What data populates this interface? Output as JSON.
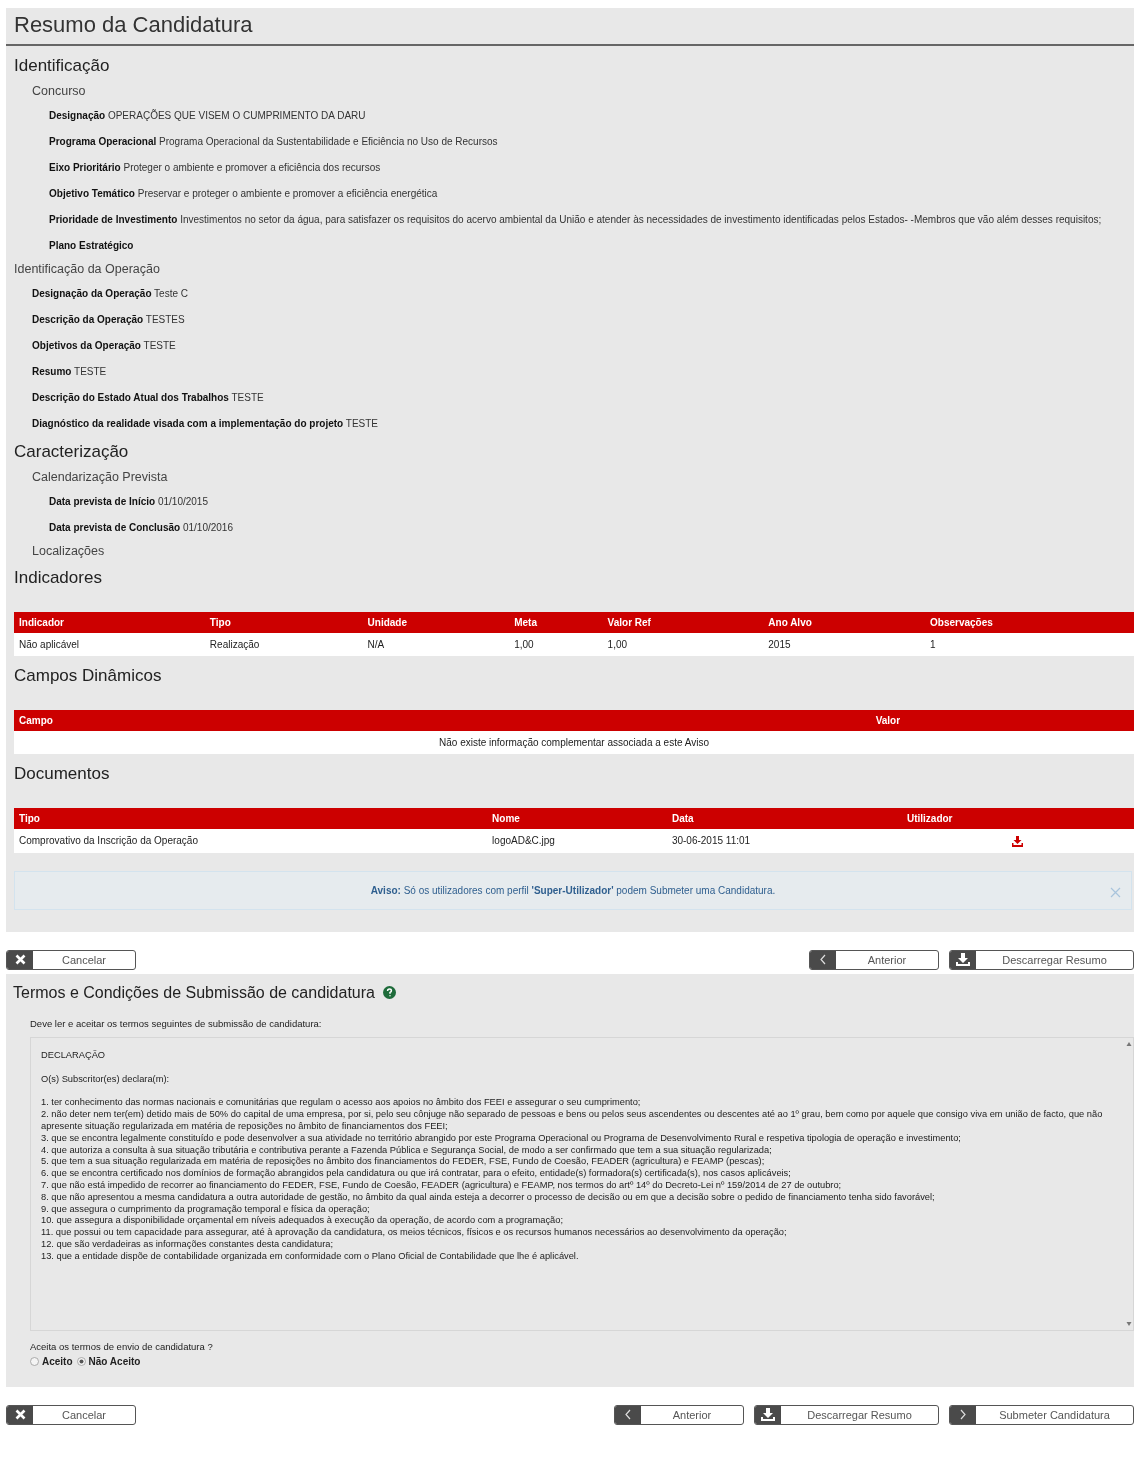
{
  "title": "Resumo da Candidatura",
  "sections": [
    {
      "heading": "Identificação",
      "groups": [
        {
          "kind": "subsection",
          "title": "Concurso",
          "fields": [
            {
              "label": "Designação",
              "value": "OPERAÇÕES QUE VISEM O CUMPRIMENTO DA DARU"
            },
            {
              "label": "Programa Operacional",
              "value": "Programa Operacional da Sustentabilidade e Eficiência no Uso de Recursos"
            },
            {
              "label": "Eixo Prioritário",
              "value": "Proteger o ambiente e promover a eficiência dos recursos"
            },
            {
              "label": "Objetivo Temático",
              "value": "Preservar e proteger o ambiente e promover a eficiência energética"
            },
            {
              "label": "Prioridade de Investimento",
              "value": "Investimentos no setor da água, para satisfazer os requisitos do acervo ambiental da União e atender às necessidades de investimento identificadas pelos Estados- -Membros que vão além desses requisitos;"
            },
            {
              "label": "Plano Estratégico"
            }
          ]
        },
        {
          "kind": "block",
          "title": "Identificação da Operação",
          "fields": [
            {
              "label": "Designação da Operação",
              "value": "Teste C"
            },
            {
              "label": "Descrição da Operação",
              "value": "TESTES"
            },
            {
              "label": "Objetivos da Operação",
              "value": "TESTE"
            },
            {
              "label": "Resumo",
              "value": "TESTE"
            },
            {
              "label": "Descrição do Estado Atual dos Trabalhos",
              "value": "TESTE"
            },
            {
              "label": "Diagnóstico da realidade visada com a implementação do projeto",
              "value": "TESTE"
            }
          ]
        }
      ]
    },
    {
      "heading": "Caracterização",
      "groups": [
        {
          "kind": "subsection",
          "title": "Calendarização Prevista",
          "fields": [
            {
              "label": "Data prevista de Início",
              "value": "01/10/2015"
            },
            {
              "label": "Data prevista de Conclusão",
              "value": "01/10/2016"
            }
          ]
        },
        {
          "kind": "subsection",
          "title": "Localizações"
        }
      ]
    },
    {
      "heading": "Indicadores",
      "table": {
        "columns": [
          "Indicador",
          "Tipo",
          "Unidade",
          "Meta",
          "Valor Ref",
          "Ano Alvo",
          "Observações"
        ],
        "rows": [
          {
            "cells": [
              "Não aplicável",
              "Realização",
              "N/A",
              "1,00",
              "1,00",
              "2015",
              "1"
            ]
          }
        ]
      }
    },
    {
      "heading": "Campos Dinâmicos",
      "table": {
        "columns": [
          "Campo",
          "Valor"
        ],
        "empty_message": "Não existe informação complementar associada a este Aviso"
      }
    },
    {
      "heading": "Documentos",
      "table": {
        "columns": [
          "Tipo",
          "Nome",
          "Data",
          "Utilizador"
        ],
        "rows": [
          {
            "cells": [
              "Comprovativo da Inscrição da Operação",
              "logoAD&C.jpg",
              "30-06-2015 11:01"
            ],
            "downloadable": true
          }
        ]
      }
    }
  ],
  "notice": {
    "text": "**Aviso:** Só os utilizadores com perfil **'Super-Utilizador'** podem Submeter uma Candidatura.",
    "dismissible": true
  },
  "buttons_top": [
    {
      "label": "Cancelar",
      "kind": "cancel"
    },
    {
      "label": "Anterior",
      "kind": "previous"
    },
    {
      "label": "Descarregar Resumo",
      "kind": "download"
    }
  ],
  "terms": {
    "title": "Termos e Condições de Submissão de candidatura",
    "intro": "Deve ler e aceitar os termos seguintes de submissão de candidatura:",
    "declaration": {
      "heading": "DECLARAÇÃO",
      "intro": "O(s) Subscritor(es) declara(m):",
      "items": [
        "1. ter conhecimento das normas nacionais e comunitárias que regulam o acesso aos apoios no âmbito dos FEEI e assegurar o seu cumprimento;",
        "2. não deter nem ter(em) detido mais de 50% do capital de uma empresa, por si, pelo seu cônjuge não separado de pessoas e bens ou pelos seus ascendentes ou descentes até ao 1º grau, bem como por aquele que consigo viva em união de facto, que não apresente situação regularizada em matéria de reposições no âmbito de financiamentos dos FEEI;",
        "3. que se encontra legalmente constituído e pode desenvolver a sua atividade no território abrangido por este Programa Operacional ou Programa de Desenvolvimento Rural e respetiva tipologia de operação e investimento;",
        "4. que autoriza a consulta à sua situação tributária e contributiva perante a Fazenda Pública e Segurança Social, de modo a ser confirmado que tem a sua situação regularizada;",
        "5. que tem a sua situação regularizada em matéria de reposições no âmbito dos financiamentos do FEDER, FSE, Fundo de Coesão, FEADER (agricultura) e FEAMP (pescas);",
        "6. que se encontra certificado nos domínios de formação abrangidos pela candidatura ou que irá contratar, para o efeito, entidade(s) formadora(s) certificada(s), nos casos aplicáveis;",
        "7. que não está impedido de recorrer ao financiamento do FEDER, FSE, Fundo de Coesão, FEADER (agricultura) e FEAMP, nos termos do artº 14º do Decreto-Lei nº 159/2014 de 27 de outubro;",
        "8. que não apresentou a mesma candidatura a outra autoridade de gestão, no âmbito da qual ainda esteja a decorrer o processo de decisão ou em que a decisão sobre o pedido de financiamento tenha sido favorável;",
        "9. que assegura o cumprimento da programação temporal e física da operação;",
        "10. que assegura a disponibilidade orçamental em níveis adequados à execução da operação, de acordo com a programação;",
        "11. que possui ou tem capacidade para assegurar, até à aprovação da candidatura, os meios técnicos, físicos e os recursos humanos necessários ao desenvolvimento da operação;",
        "12. que são verdadeiras as informações constantes desta candidatura;",
        "13. que a entidade dispõe de contabilidade organizada em conformidade com o Plano Oficial de Contabilidade que lhe é aplicável."
      ]
    },
    "question": "Aceita os termos de envio de candidatura ?",
    "options": [
      {
        "label": "Aceito",
        "selected": false
      },
      {
        "label": "Não Aceito",
        "selected": true
      }
    ]
  },
  "buttons_bottom": [
    {
      "label": "Cancelar",
      "kind": "cancel"
    },
    {
      "label": "Anterior",
      "kind": "previous"
    },
    {
      "label": "Descarregar Resumo",
      "kind": "download"
    },
    {
      "label": "Submeter Candidatura",
      "kind": "submit"
    }
  ]
}
